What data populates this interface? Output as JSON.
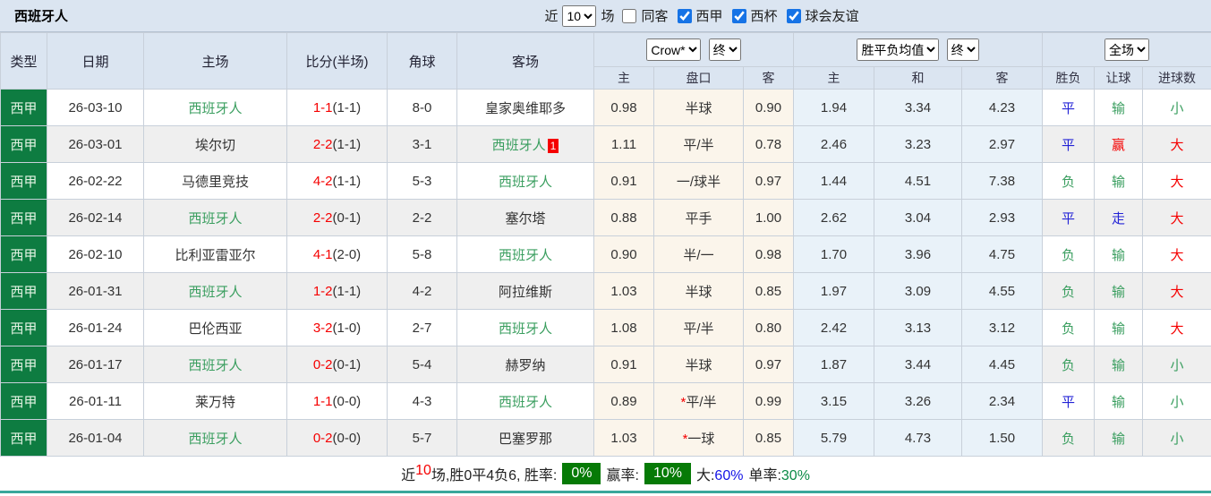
{
  "colors": {
    "league_green": "#0e7c41",
    "team_green": "#3a9e5f",
    "score_red": "#f50000",
    "result_blue": "#2323d6",
    "badge_green": "#067a06",
    "big_blue": "#1414e6",
    "single_green": "#0a8a46",
    "teal_line": "#3aa79b"
  },
  "topbar": {
    "title": "西班牙人",
    "recent_label": "近",
    "recent_value": "10",
    "matches_label": "场",
    "checkboxes": [
      {
        "label": "同客",
        "checked": false
      },
      {
        "label": "西甲",
        "checked": true
      },
      {
        "label": "西杯",
        "checked": true
      },
      {
        "label": "球会友谊",
        "checked": true
      }
    ]
  },
  "table": {
    "col_headers": {
      "type": "类型",
      "date": "日期",
      "home": "主场",
      "score": "比分(半场)",
      "corners": "角球",
      "away": "客场"
    },
    "selects": {
      "bookmaker": "Crow*",
      "bookmaker_time": "终",
      "odds": "胜平负均值",
      "odds_time": "终",
      "scope": "全场"
    },
    "sub_headers": [
      "主",
      "盘口",
      "客",
      "主",
      "和",
      "客",
      "胜负",
      "让球",
      "进球数"
    ],
    "rows": [
      {
        "league": "西甲",
        "date": "26-03-10",
        "home": {
          "name": "西班牙人",
          "team": true,
          "badge": ""
        },
        "score": "1-1",
        "half": "(1-1)",
        "corners": "8-0",
        "away": {
          "name": "皇家奥维耶多",
          "team": false,
          "badge": ""
        },
        "ah_home": "0.98",
        "ah_star": "",
        "ah_line": "半球",
        "ah_away": "0.90",
        "odd_home": "1.94",
        "odd_draw": "3.34",
        "odd_away": "4.23",
        "result": "平",
        "result_color": "blue",
        "handicap_result": "输",
        "handicap_result_color": "green",
        "goals": "小",
        "goals_color": "green"
      },
      {
        "league": "西甲",
        "date": "26-03-01",
        "home": {
          "name": "埃尔切",
          "team": false,
          "badge": ""
        },
        "score": "2-2",
        "half": "(1-1)",
        "corners": "3-1",
        "away": {
          "name": "西班牙人",
          "team": true,
          "badge": "1"
        },
        "ah_home": "1.11",
        "ah_star": "",
        "ah_line": "平/半",
        "ah_away": "0.78",
        "odd_home": "2.46",
        "odd_draw": "3.23",
        "odd_away": "2.97",
        "result": "平",
        "result_color": "blue",
        "handicap_result": "赢",
        "handicap_result_color": "red",
        "goals": "大",
        "goals_color": "red"
      },
      {
        "league": "西甲",
        "date": "26-02-22",
        "home": {
          "name": "马德里竞技",
          "team": false,
          "badge": ""
        },
        "score": "4-2",
        "half": "(1-1)",
        "corners": "5-3",
        "away": {
          "name": "西班牙人",
          "team": true,
          "badge": ""
        },
        "ah_home": "0.91",
        "ah_star": "",
        "ah_line": "一/球半",
        "ah_away": "0.97",
        "odd_home": "1.44",
        "odd_draw": "4.51",
        "odd_away": "7.38",
        "result": "负",
        "result_color": "green",
        "handicap_result": "输",
        "handicap_result_color": "green",
        "goals": "大",
        "goals_color": "red"
      },
      {
        "league": "西甲",
        "date": "26-02-14",
        "home": {
          "name": "西班牙人",
          "team": true,
          "badge": ""
        },
        "score": "2-2",
        "half": "(0-1)",
        "corners": "2-2",
        "away": {
          "name": "塞尔塔",
          "team": false,
          "badge": ""
        },
        "ah_home": "0.88",
        "ah_star": "",
        "ah_line": "平手",
        "ah_away": "1.00",
        "odd_home": "2.62",
        "odd_draw": "3.04",
        "odd_away": "2.93",
        "result": "平",
        "result_color": "blue",
        "handicap_result": "走",
        "handicap_result_color": "blue",
        "goals": "大",
        "goals_color": "red"
      },
      {
        "league": "西甲",
        "date": "26-02-10",
        "home": {
          "name": "比利亚雷亚尔",
          "team": false,
          "badge": ""
        },
        "score": "4-1",
        "half": "(2-0)",
        "corners": "5-8",
        "away": {
          "name": "西班牙人",
          "team": true,
          "badge": ""
        },
        "ah_home": "0.90",
        "ah_star": "",
        "ah_line": "半/一",
        "ah_away": "0.98",
        "odd_home": "1.70",
        "odd_draw": "3.96",
        "odd_away": "4.75",
        "result": "负",
        "result_color": "green",
        "handicap_result": "输",
        "handicap_result_color": "green",
        "goals": "大",
        "goals_color": "red"
      },
      {
        "league": "西甲",
        "date": "26-01-31",
        "home": {
          "name": "西班牙人",
          "team": true,
          "badge": ""
        },
        "score": "1-2",
        "half": "(1-1)",
        "corners": "4-2",
        "away": {
          "name": "阿拉维斯",
          "team": false,
          "badge": ""
        },
        "ah_home": "1.03",
        "ah_star": "",
        "ah_line": "半球",
        "ah_away": "0.85",
        "odd_home": "1.97",
        "odd_draw": "3.09",
        "odd_away": "4.55",
        "result": "负",
        "result_color": "green",
        "handicap_result": "输",
        "handicap_result_color": "green",
        "goals": "大",
        "goals_color": "red"
      },
      {
        "league": "西甲",
        "date": "26-01-24",
        "home": {
          "name": "巴伦西亚",
          "team": false,
          "badge": ""
        },
        "score": "3-2",
        "half": "(1-0)",
        "corners": "2-7",
        "away": {
          "name": "西班牙人",
          "team": true,
          "badge": ""
        },
        "ah_home": "1.08",
        "ah_star": "",
        "ah_line": "平/半",
        "ah_away": "0.80",
        "odd_home": "2.42",
        "odd_draw": "3.13",
        "odd_away": "3.12",
        "result": "负",
        "result_color": "green",
        "handicap_result": "输",
        "handicap_result_color": "green",
        "goals": "大",
        "goals_color": "red"
      },
      {
        "league": "西甲",
        "date": "26-01-17",
        "home": {
          "name": "西班牙人",
          "team": true,
          "badge": ""
        },
        "score": "0-2",
        "half": "(0-1)",
        "corners": "5-4",
        "away": {
          "name": "赫罗纳",
          "team": false,
          "badge": ""
        },
        "ah_home": "0.91",
        "ah_star": "",
        "ah_line": "半球",
        "ah_away": "0.97",
        "odd_home": "1.87",
        "odd_draw": "3.44",
        "odd_away": "4.45",
        "result": "负",
        "result_color": "green",
        "handicap_result": "输",
        "handicap_result_color": "green",
        "goals": "小",
        "goals_color": "green"
      },
      {
        "league": "西甲",
        "date": "26-01-11",
        "home": {
          "name": "莱万特",
          "team": false,
          "badge": ""
        },
        "score": "1-1",
        "half": "(0-0)",
        "corners": "4-3",
        "away": {
          "name": "西班牙人",
          "team": true,
          "badge": ""
        },
        "ah_home": "0.89",
        "ah_star": "*",
        "ah_line": "平/半",
        "ah_away": "0.99",
        "odd_home": "3.15",
        "odd_draw": "3.26",
        "odd_away": "2.34",
        "result": "平",
        "result_color": "blue",
        "handicap_result": "输",
        "handicap_result_color": "green",
        "goals": "小",
        "goals_color": "green"
      },
      {
        "league": "西甲",
        "date": "26-01-04",
        "home": {
          "name": "西班牙人",
          "team": true,
          "badge": ""
        },
        "score": "0-2",
        "half": "(0-0)",
        "corners": "5-7",
        "away": {
          "name": "巴塞罗那",
          "team": false,
          "badge": ""
        },
        "ah_home": "1.03",
        "ah_star": "*",
        "ah_line": "一球",
        "ah_away": "0.85",
        "odd_home": "5.79",
        "odd_draw": "4.73",
        "odd_away": "1.50",
        "result": "负",
        "result_color": "green",
        "handicap_result": "输",
        "handicap_result_color": "green",
        "goals": "小",
        "goals_color": "green"
      }
    ]
  },
  "footer": {
    "prefix": "近",
    "count": "10",
    "middle": "场,胜0平4负6, 胜率:",
    "win_rate": "0%",
    "profit_label": "赢率:",
    "profit_rate": "10%",
    "big_label": "大:",
    "big_value": "60%",
    "single_label": "单率:",
    "single_value": "30%"
  }
}
